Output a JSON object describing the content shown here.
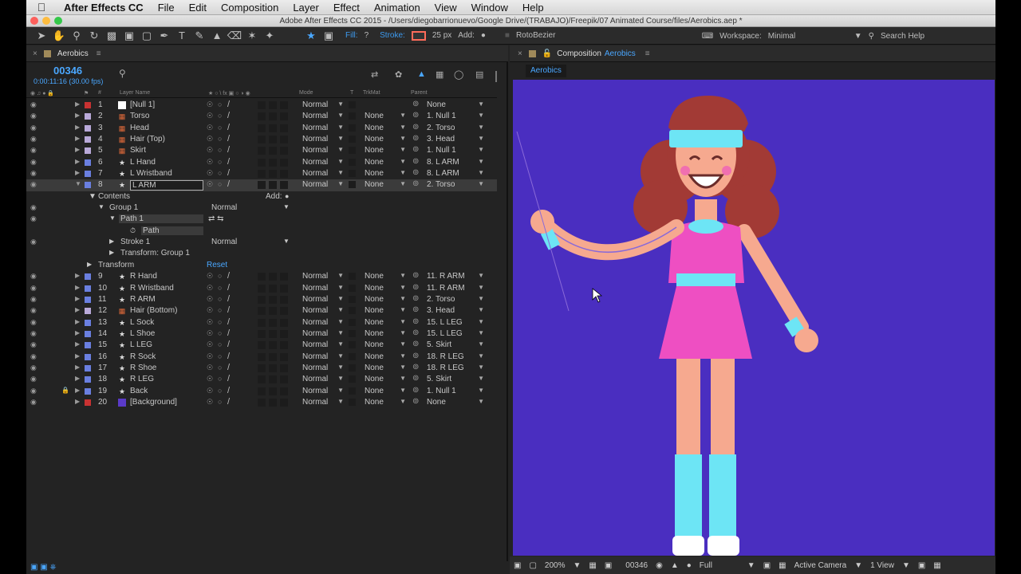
{
  "menubar": {
    "app_name": "After Effects CC",
    "items": [
      "File",
      "Edit",
      "Composition",
      "Layer",
      "Effect",
      "Animation",
      "View",
      "Window",
      "Help"
    ]
  },
  "window_title": "Adobe After Effects CC 2015 - /Users/diegobarrionuevo/Google Drive/(TRABAJO)/Freepik/07 Animated Course/files/Aerobics.aep *",
  "toolbar": {
    "fill_label": "Fill:",
    "fill_value": "?",
    "stroke_label": "Stroke:",
    "stroke_width": "25 px",
    "add_label": "Add:",
    "rotobezier": "RotoBezier",
    "workspace_label": "Workspace:",
    "workspace_value": "Minimal",
    "search_help": "Search Help"
  },
  "timeline": {
    "tab_title": "Aerobics",
    "timecode": "00346",
    "time_fps": "0:00:11:16 (30.00 fps)",
    "columns": {
      "layer_name": "Layer Name",
      "mode": "Mode",
      "t": "T",
      "trkmat": "TrkMat",
      "parent": "Parent"
    },
    "layers": [
      {
        "num": "1",
        "name": "[Null 1]",
        "mode": "Normal",
        "trkmat": "",
        "parent": "None",
        "label_color": "#c83232",
        "type": "null"
      },
      {
        "num": "2",
        "name": "Torso",
        "mode": "Normal",
        "trkmat": "None",
        "parent": "1. Null 1",
        "label_color": "#b9a9d9",
        "type": "comp"
      },
      {
        "num": "3",
        "name": "Head",
        "mode": "Normal",
        "trkmat": "None",
        "parent": "2. Torso",
        "label_color": "#b9a9d9",
        "type": "comp"
      },
      {
        "num": "4",
        "name": "Hair (Top)",
        "mode": "Normal",
        "trkmat": "None",
        "parent": "3. Head",
        "label_color": "#b9a9d9",
        "type": "comp"
      },
      {
        "num": "5",
        "name": "Skirt",
        "mode": "Normal",
        "trkmat": "None",
        "parent": "1. Null 1",
        "label_color": "#b9a9d9",
        "type": "comp"
      },
      {
        "num": "6",
        "name": "L Hand",
        "mode": "Normal",
        "trkmat": "None",
        "parent": "8. L ARM",
        "label_color": "#6a7fe0",
        "type": "shape"
      },
      {
        "num": "7",
        "name": "L Wristband",
        "mode": "Normal",
        "trkmat": "None",
        "parent": "8. L ARM",
        "label_color": "#6a7fe0",
        "type": "shape"
      },
      {
        "num": "8",
        "name": "L ARM",
        "mode": "Normal",
        "trkmat": "None",
        "parent": "2. Torso",
        "label_color": "#6a7fe0",
        "type": "shape",
        "selected": true
      }
    ],
    "contents": {
      "contents_label": "Contents",
      "add_label": "Add:",
      "group_label": "Group 1",
      "group_mode": "Normal",
      "path1_label": "Path 1",
      "path_label": "Path",
      "stroke_label": "Stroke 1",
      "stroke_mode": "Normal",
      "transform_group": "Transform: Group 1",
      "transform_label": "Transform",
      "reset_label": "Reset"
    },
    "layers2": [
      {
        "num": "9",
        "name": "R Hand",
        "mode": "Normal",
        "trkmat": "None",
        "parent": "11. R ARM",
        "label_color": "#6a7fe0",
        "type": "shape"
      },
      {
        "num": "10",
        "name": "R Wristband",
        "mode": "Normal",
        "trkmat": "None",
        "parent": "11. R ARM",
        "label_color": "#6a7fe0",
        "type": "shape"
      },
      {
        "num": "11",
        "name": "R ARM",
        "mode": "Normal",
        "trkmat": "None",
        "parent": "2. Torso",
        "label_color": "#6a7fe0",
        "type": "shape"
      },
      {
        "num": "12",
        "name": "Hair (Bottom)",
        "mode": "Normal",
        "trkmat": "None",
        "parent": "3. Head",
        "label_color": "#b9a9d9",
        "type": "comp"
      },
      {
        "num": "13",
        "name": "L Sock",
        "mode": "Normal",
        "trkmat": "None",
        "parent": "15. L LEG",
        "label_color": "#6a7fe0",
        "type": "shape"
      },
      {
        "num": "14",
        "name": "L Shoe",
        "mode": "Normal",
        "trkmat": "None",
        "parent": "15. L LEG",
        "label_color": "#6a7fe0",
        "type": "shape"
      },
      {
        "num": "15",
        "name": "L LEG",
        "mode": "Normal",
        "trkmat": "None",
        "parent": "5. Skirt",
        "label_color": "#6a7fe0",
        "type": "shape"
      },
      {
        "num": "16",
        "name": "R Sock",
        "mode": "Normal",
        "trkmat": "None",
        "parent": "18. R LEG",
        "label_color": "#6a7fe0",
        "type": "shape"
      },
      {
        "num": "17",
        "name": "R Shoe",
        "mode": "Normal",
        "trkmat": "None",
        "parent": "18. R LEG",
        "label_color": "#6a7fe0",
        "type": "shape"
      },
      {
        "num": "18",
        "name": "R LEG",
        "mode": "Normal",
        "trkmat": "None",
        "parent": "5. Skirt",
        "label_color": "#6a7fe0",
        "type": "shape"
      },
      {
        "num": "19",
        "name": "Back",
        "mode": "Normal",
        "trkmat": "None",
        "parent": "1. Null 1",
        "label_color": "#6a7fe0",
        "type": "shape",
        "locked": true
      },
      {
        "num": "20",
        "name": "[Background]",
        "mode": "Normal",
        "trkmat": "None",
        "parent": "None",
        "label_color": "#c83232",
        "type": "solid"
      }
    ]
  },
  "composition": {
    "tab_prefix": "Composition",
    "tab_name": "Aerobics",
    "subtab": "Aerobics",
    "zoom": "200%",
    "timecode": "00346",
    "resolution": "Full",
    "camera": "Active Camera",
    "views": "1 View",
    "bg_color": "#4a2ec0"
  }
}
